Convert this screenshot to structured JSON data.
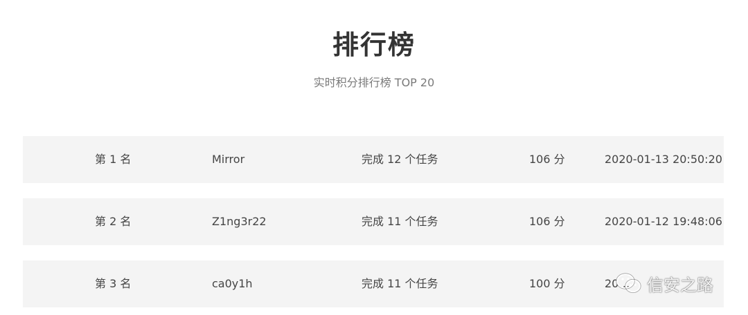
{
  "header": {
    "title": "排行榜",
    "subtitle": "实时积分排行榜 TOP 20"
  },
  "leaderboard": {
    "rows": [
      {
        "rank": "第 1 名",
        "name": "Mirror",
        "tasks": "完成 12 个任务",
        "score": "106 分",
        "time": "2020-01-13 20:50:20"
      },
      {
        "rank": "第 2 名",
        "name": "Z1ng3r22",
        "tasks": "完成 11 个任务",
        "score": "106 分",
        "time": "2020-01-12 19:48:06"
      },
      {
        "rank": "第 3 名",
        "name": "ca0y1h",
        "tasks": "完成 11 个任务",
        "score": "100 分",
        "time": "20…"
      }
    ]
  },
  "watermark": {
    "text": "信安之路",
    "icon": "wechat-icon"
  }
}
